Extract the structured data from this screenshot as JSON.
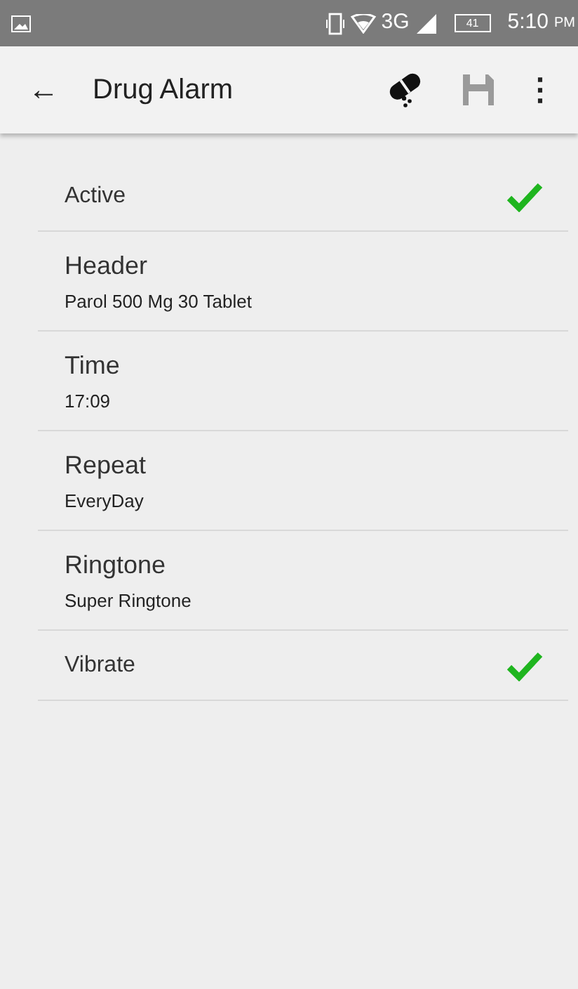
{
  "status_bar": {
    "network": "3G",
    "battery": "41",
    "time": "5:10",
    "meridiem": "PM"
  },
  "app_bar": {
    "back": "←",
    "title": "Drug Alarm",
    "menu": "⋮"
  },
  "settings": [
    {
      "kind": "check",
      "title": "Active",
      "checked": true
    },
    {
      "kind": "detail",
      "title": "Header",
      "summary": "Parol 500 Mg 30 Tablet"
    },
    {
      "kind": "detail",
      "title": "Time",
      "summary": "17:09"
    },
    {
      "kind": "detail",
      "title": "Repeat",
      "summary": "EveryDay"
    },
    {
      "kind": "detail",
      "title": "Ringtone",
      "summary": "Super Ringtone"
    },
    {
      "kind": "check",
      "title": "Vibrate",
      "checked": true
    }
  ]
}
